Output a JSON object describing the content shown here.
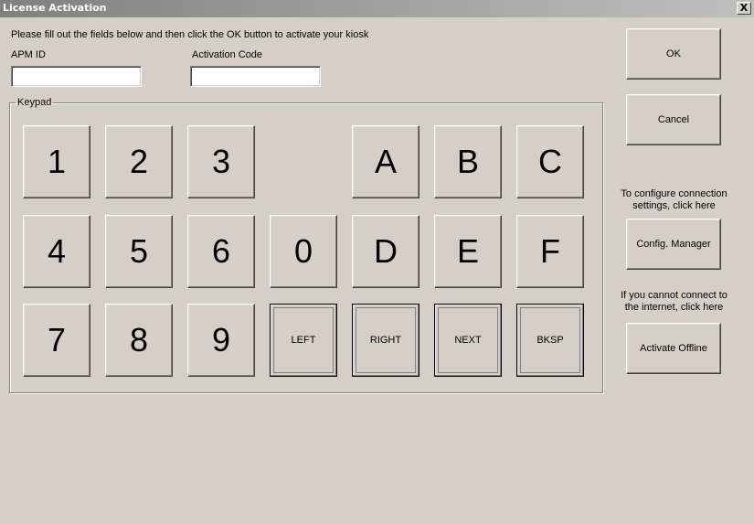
{
  "window": {
    "title": "License Activation",
    "close_glyph": "X"
  },
  "instructions": "Please fill out the fields below and then click the OK button to activate your kiosk",
  "fields": {
    "apm_id": {
      "label": "APM ID",
      "value": ""
    },
    "activation_code": {
      "label": "Activation Code",
      "value": ""
    }
  },
  "keypad": {
    "legend": "Keypad",
    "keys": {
      "k1": "1",
      "k2": "2",
      "k3": "3",
      "kA": "A",
      "kB": "B",
      "kC": "C",
      "k4": "4",
      "k5": "5",
      "k6": "6",
      "k0": "0",
      "kD": "D",
      "kE": "E",
      "kF": "F",
      "k7": "7",
      "k8": "8",
      "k9": "9",
      "left": "LEFT",
      "right": "RIGHT",
      "next": "NEXT",
      "bksp": "BKSP"
    }
  },
  "side": {
    "ok": "OK",
    "cancel": "Cancel",
    "config_note_1": "To configure connection",
    "config_note_2": "settings, click here",
    "config_button": "Config. Manager",
    "offline_note_1": "If you cannot connect to",
    "offline_note_2": "the internet, click here",
    "offline_button": "Activate Offline"
  }
}
